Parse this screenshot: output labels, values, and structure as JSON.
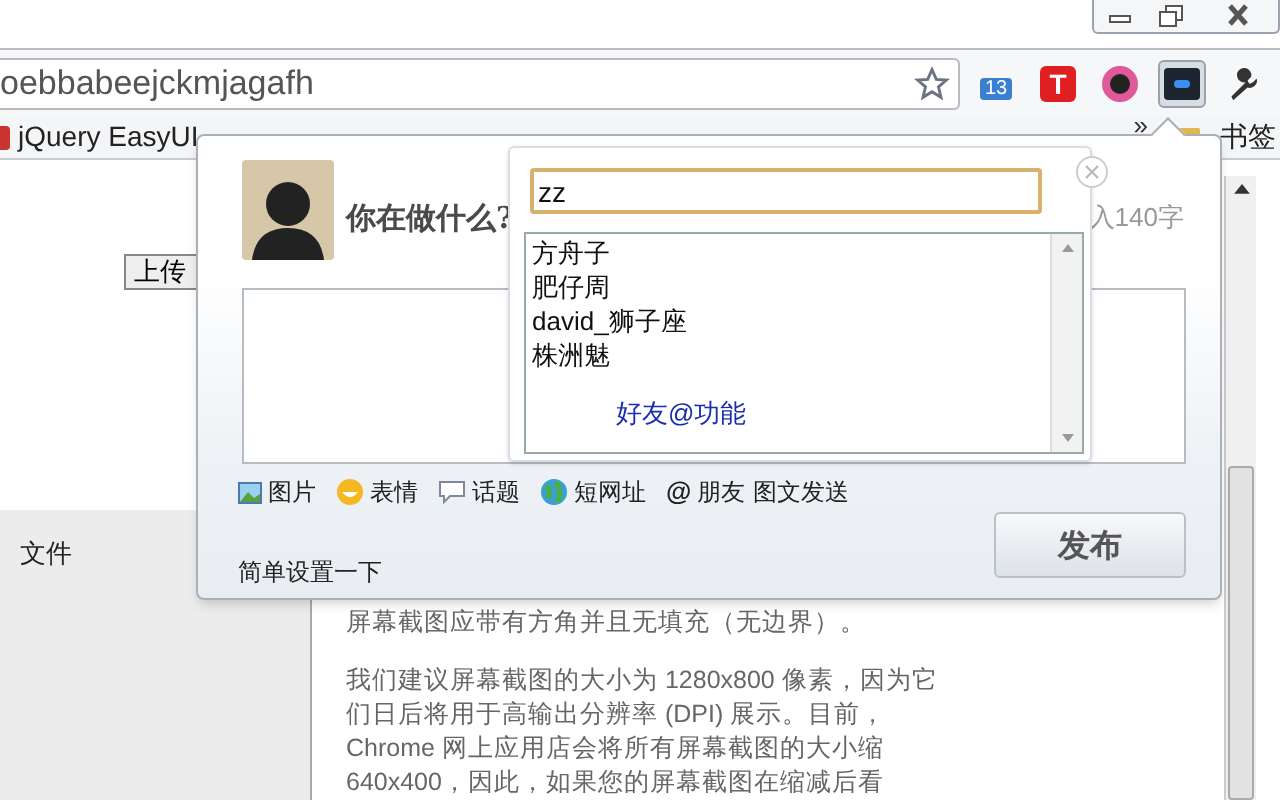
{
  "address_bar": {
    "url": "oebbabeejckmjagafh"
  },
  "extensions": [
    {
      "kind": "calendar",
      "label": "13",
      "selected": false
    },
    {
      "kind": "letter",
      "label": "T",
      "selected": false
    },
    {
      "kind": "ring",
      "selected": false
    },
    {
      "kind": "weibo",
      "selected": true
    },
    {
      "kind": "wrench",
      "selected": false
    }
  ],
  "bookmarks_bar": {
    "items": [
      "jQuery EasyUI"
    ],
    "overflow": "»",
    "other_bookmarks": "书签"
  },
  "page": {
    "upload_button": "上传",
    "file_label": "文件",
    "paragraphs": [
      [
        "屏幕截图应带有方角并且无填充（无边界）。"
      ],
      [
        "我们建议屏幕截图的大小为 1280x800 像素，因为它",
        "们日后将用于高输出分辨率 (DPI) 展示。目前，",
        "Chrome 网上应用店会将所有屏幕截图的大小缩",
        "640x400，因此，如果您的屏幕截图在缩减后看"
      ]
    ]
  },
  "popup": {
    "prompt": "你在做什么?",
    "counter": "入140字",
    "tools": [
      {
        "kind": "image",
        "label": "图片"
      },
      {
        "kind": "emoticon",
        "label": "表情"
      },
      {
        "kind": "topic",
        "label": "话题"
      },
      {
        "kind": "short_url",
        "label": "短网址"
      },
      {
        "kind": "at",
        "symbol": "@",
        "label": "朋友"
      },
      {
        "kind": "text",
        "label": "图文发送"
      }
    ],
    "settings_link": "简单设置一下",
    "publish_button": "发布",
    "mention": {
      "query": "zz",
      "suggestions": [
        "方舟子",
        "肥仔周",
        "david_狮子座",
        "株洲魅"
      ],
      "hint": "好友@功能"
    }
  }
}
